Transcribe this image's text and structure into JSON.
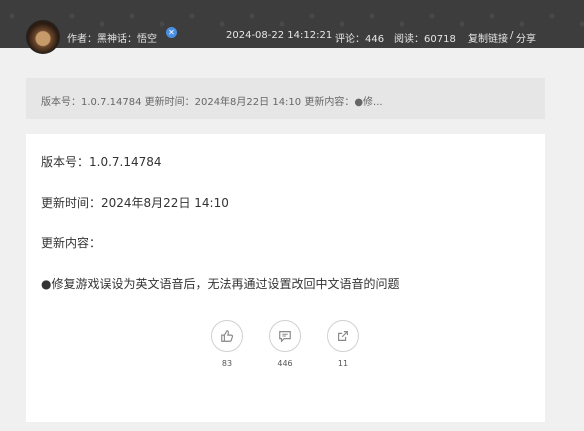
{
  "header": {
    "author": "作者：黑神话：悟空",
    "cert_icon": "certification-icon",
    "date": "2024-08-22 14:12:21",
    "comments": "评论：446",
    "reads": "阅读：60718",
    "copy_link": "复制链接",
    "separator": "/",
    "share": "分享"
  },
  "summary": {
    "text": "版本号：1.0.7.14784 更新时间：2024年8月22日 14:10 更新内容：●修..."
  },
  "article": {
    "version": "版本号：1.0.7.14784",
    "update_time": "更新时间：2024年8月22日 14:10",
    "content_label": "更新内容：",
    "content_item": "●修复游戏误设为英文语音后，无法再通过设置改回中文语音的问题"
  },
  "actions": {
    "like_count": "83",
    "comment_count": "446",
    "share_count": "11"
  }
}
